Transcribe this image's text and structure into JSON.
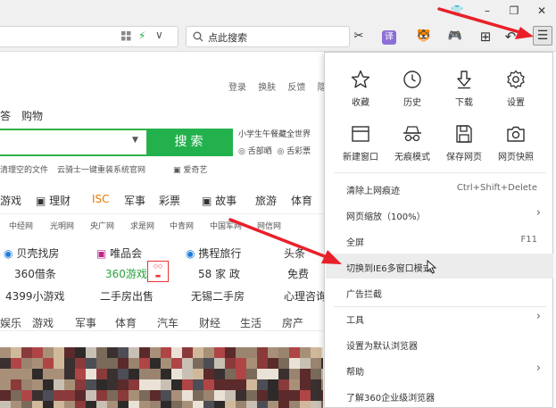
{
  "window": {
    "controls": {
      "shirt": "👕",
      "minimize": "–",
      "maximize": "❐",
      "close": "✕"
    }
  },
  "toolbar": {
    "search_placeholder": "点此搜索",
    "icons": {
      "grid": "▦",
      "bolt": "⚡",
      "chevron": "∨",
      "scissors": "✂",
      "translate": "译",
      "pet": "🐯",
      "game": "🎮",
      "apps": "⊞",
      "undo": "↶",
      "menu": "☰"
    }
  },
  "page": {
    "top_links": [
      "登录",
      "换肤",
      "反馈",
      "隐"
    ],
    "nav": [
      "答",
      "购物"
    ],
    "search_button": "搜索",
    "hot_text": "小学生午餐藏全世界",
    "hot_links": [
      "舌部晒",
      "舌彩票"
    ],
    "recent": [
      "清理空的文件",
      "云骑士一键重装系统官网",
      "爱奇艺"
    ],
    "categories": [
      "游戏",
      "理财",
      "ISC",
      "军事",
      "彩票",
      "故事",
      "旅游",
      "体育"
    ],
    "sites": [
      "中经网",
      "光明网",
      "央广网",
      "求是网",
      "中青网",
      "中国军网",
      "网信网"
    ],
    "grid": {
      "row1": [
        "贝壳找房",
        "唯品会",
        "携程旅行",
        "头条"
      ],
      "row2": [
        "360借条",
        "360游戏",
        "58 家 政",
        "免费"
      ],
      "row3": [
        "4399小游戏",
        "二手房出售",
        "无锡二手房",
        "心理咨询"
      ]
    },
    "lower_tabs": [
      "娱乐",
      "游戏",
      "军事",
      "体育",
      "汽车",
      "财经",
      "生活",
      "房产"
    ]
  },
  "menu": {
    "quick": [
      {
        "label": "收藏",
        "icon": "star-icon"
      },
      {
        "label": "历史",
        "icon": "clock-icon"
      },
      {
        "label": "下载",
        "icon": "download-icon"
      },
      {
        "label": "设置",
        "icon": "gear-icon"
      },
      {
        "label": "新建窗口",
        "icon": "window-icon"
      },
      {
        "label": "无痕模式",
        "icon": "incognito-icon"
      },
      {
        "label": "保存网页",
        "icon": "save-icon"
      },
      {
        "label": "网页快照",
        "icon": "camera-icon"
      }
    ],
    "items": [
      {
        "label": "清除上网痕迹",
        "shortcut": "Ctrl+Shift+Delete"
      },
      {
        "label": "网页缩放（100%）",
        "arrow": "›"
      },
      {
        "label": "全屏",
        "shortcut": "F11"
      },
      {
        "label": "切换到IE6多窗口模式"
      },
      {
        "label": "广告拦截"
      },
      {
        "label": "工具",
        "arrow": "›"
      },
      {
        "label": "设置为默认浏览器"
      },
      {
        "label": "帮助",
        "arrow": "›"
      },
      {
        "label": "了解360企业级浏览器"
      }
    ]
  },
  "colors": {
    "accent_green": "#23b14d",
    "annotation_red": "#e8202a",
    "menu_highlight": "#ececec"
  }
}
